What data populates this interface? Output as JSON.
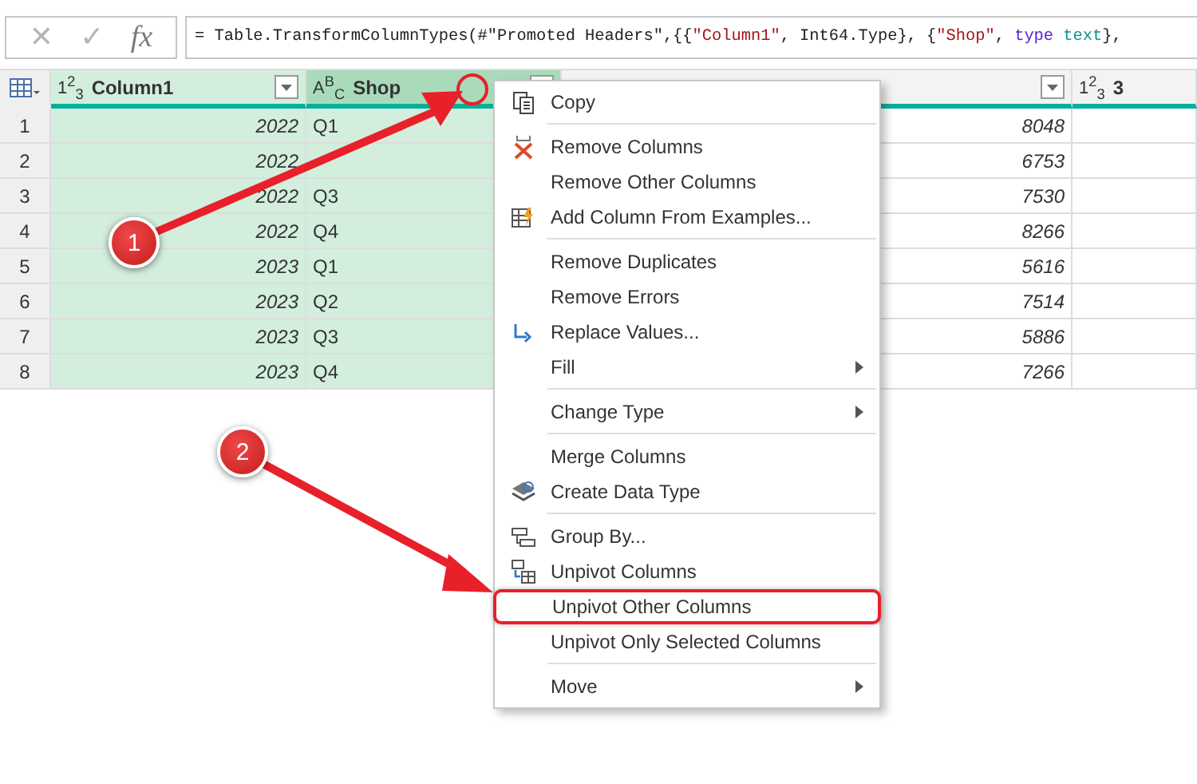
{
  "formula_bar": {
    "cancel": "✕",
    "confirm": "✓",
    "function": "fx",
    "formula": [
      {
        "kind": "plain",
        "text": "= Table.TransformColumnTypes(#\"Promoted Headers\",{{"
      },
      {
        "kind": "string",
        "text": "\"Column1\""
      },
      {
        "kind": "plain",
        "text": ", Int64.Type}, {"
      },
      {
        "kind": "string",
        "text": "\"Shop\""
      },
      {
        "kind": "plain",
        "text": ", "
      },
      {
        "kind": "keyword",
        "text": "type"
      },
      {
        "kind": "typename",
        "text": " text"
      },
      {
        "kind": "plain",
        "text": "},"
      }
    ]
  },
  "table": {
    "columns": [
      {
        "type_icon": "1$^{2}$$_{3}$",
        "label": "Column1",
        "selected": true,
        "active": false
      },
      {
        "type_icon": "A$^{B}$$_{C}$",
        "label": "Shop",
        "selected": true,
        "active": true
      },
      {
        "selected": false,
        "active": false
      },
      {
        "type_icon": "1$^{2}$$_{3}$",
        "label": "3",
        "selected": false,
        "active": false
      }
    ],
    "rows": [
      {
        "number": "1",
        "cells": [
          "2022",
          "Q1",
          "8048"
        ]
      },
      {
        "number": "2",
        "cells": [
          "2022",
          null,
          "6753"
        ]
      },
      {
        "number": "3",
        "cells": [
          "2022",
          "Q3",
          "7530"
        ]
      },
      {
        "number": "4",
        "cells": [
          "2022",
          "Q4",
          "8266"
        ]
      },
      {
        "number": "5",
        "cells": [
          "2023",
          "Q1",
          "5616"
        ]
      },
      {
        "number": "6",
        "cells": [
          "2023",
          "Q2",
          "7514"
        ]
      },
      {
        "number": "7",
        "cells": [
          "2023",
          "Q3",
          "5886"
        ]
      },
      {
        "number": "8",
        "cells": [
          "2023",
          "Q4",
          "7266"
        ]
      }
    ]
  },
  "context_menu": {
    "groups": [
      [
        {
          "label": "Copy",
          "submenu": false,
          "selected": false
        }
      ],
      [
        {
          "label": "Remove Columns",
          "submenu": false,
          "selected": false
        },
        {
          "label": "Remove Other Columns",
          "submenu": false,
          "selected": false
        },
        {
          "label": "Add Column From Examples...",
          "submenu": false,
          "selected": false
        }
      ],
      [
        {
          "label": "Remove Duplicates",
          "submenu": false,
          "selected": false
        },
        {
          "label": "Remove Errors",
          "submenu": false,
          "selected": false
        },
        {
          "label": "Replace Values...",
          "submenu": false,
          "selected": false
        },
        {
          "label": "Fill",
          "submenu": true,
          "selected": false
        }
      ],
      [
        {
          "label": "Change Type",
          "submenu": true,
          "selected": false
        }
      ],
      [
        {
          "label": "Merge Columns",
          "submenu": false,
          "selected": false
        },
        {
          "label": "Create Data Type",
          "submenu": false,
          "selected": false
        }
      ],
      [
        {
          "label": "Group By...",
          "submenu": false,
          "selected": false
        },
        {
          "label": "Unpivot Columns",
          "submenu": false,
          "selected": false
        },
        {
          "label": "Unpivot Other Columns",
          "submenu": false,
          "selected": true
        },
        {
          "label": "Unpivot Only Selected Columns",
          "submenu": false,
          "selected": false
        }
      ],
      [
        {
          "label": "Move",
          "submenu": true,
          "selected": false
        }
      ]
    ]
  },
  "callouts": [
    {
      "label": "1"
    },
    {
      "label": "2"
    }
  ]
}
